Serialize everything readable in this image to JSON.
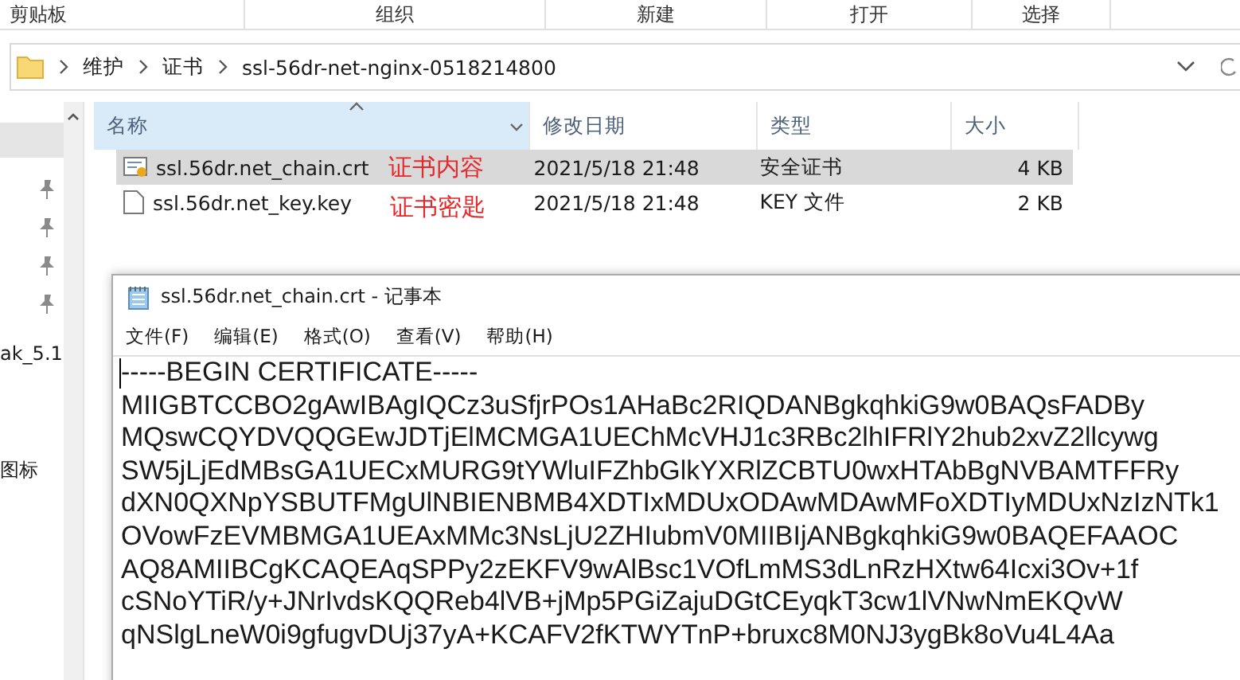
{
  "ribbon_groups": [
    "剪贴板",
    "组织",
    "新建",
    "打开",
    "选择"
  ],
  "address_bar": {
    "breadcrumb": [
      "维护",
      "证书",
      "ssl-56dr-net-nginx-0518214800"
    ]
  },
  "nav_pane": [
    {
      "kind": "selected-block"
    },
    {
      "kind": "pin"
    },
    {
      "kind": "pin"
    },
    {
      "kind": "pin"
    },
    {
      "kind": "pin"
    },
    {
      "kind": "label",
      "label": "ak_5.1"
    },
    {
      "kind": "label",
      "label": "图标"
    }
  ],
  "columns": [
    {
      "label": "名称",
      "sorted": true
    },
    {
      "label": "修改日期",
      "sorted": false
    },
    {
      "label": "类型",
      "sorted": false
    },
    {
      "label": "大小",
      "sorted": false
    }
  ],
  "files": [
    {
      "kind": "certificate",
      "name": "ssl.56dr.net_chain.crt",
      "annotation": "证书内容",
      "date": "2021/5/18 21:48",
      "type": "安全证书",
      "size": "4 KB",
      "selected": true
    },
    {
      "kind": "file",
      "name": "ssl.56dr.net_key.key",
      "annotation": "证书密匙",
      "date": "2021/5/18 21:48",
      "type": "KEY 文件",
      "size": "2 KB",
      "selected": false
    }
  ],
  "notepad": {
    "title": "ssl.56dr.net_chain.crt - 记事本",
    "menu": [
      "文件(F)",
      "编辑(E)",
      "格式(O)",
      "查看(V)",
      "帮助(H)"
    ],
    "lines": [
      "-----BEGIN CERTIFICATE-----",
      "MIIGBTCCBO2gAwIBAgIQCz3uSfjrPOs1AHaBc2RIQDANBgkqhkiG9w0BAQsFADBy",
      "MQswCQYDVQQGEwJDTjElMCMGA1UEChMcVHJ1c3RBc2lhIFRlY2hub2xvZ2llcywg",
      "SW5jLjEdMBsGA1UECxMURG9tYWluIFZhbGlkYXRlZCBTU0wxHTAbBgNVBAMTFFRy",
      "dXN0QXNpYSBUTFMgUlNBIENBMB4XDTIxMDUxODAwMDAwMFoXDTIyMDUxNzIzNTk1",
      "OVowFzEVMBMGA1UEAxMMc3NsLjU2ZHIubmV0MIIBIjANBgkqhkiG9w0BAQEFAAOC",
      "AQ8AMIIBCgKCAQEAqSPPy2zEKFV9wAlBsc1VOfLmMS3dLnRzHXtw64Icxi3Ov+1f",
      "cSNoYTiR/y+JNrIvdsKQQReb4lVB+jMp5PGiZajuDGtCEyqkT3cw1lVNwNmEKQvW",
      "qNSlgLneW0i9gfugvDUj37yA+KCAFV2fKTWYTnP+bruxc8M0NJ3ygBk8oVu4L4Aa"
    ]
  }
}
